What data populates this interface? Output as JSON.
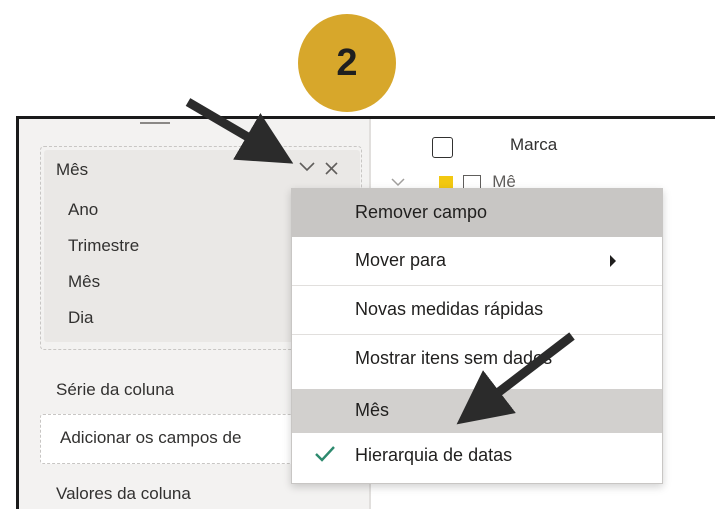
{
  "badge": {
    "number": "2",
    "color": "#d7a72b"
  },
  "left_panel": {
    "field": {
      "title": "Mês",
      "sub_items": [
        "Ano",
        "Trimestre",
        "Mês",
        "Dia"
      ]
    },
    "column_series_label": "Série da coluna",
    "column_series_placeholder": "Adicionar os campos de",
    "column_values_label": "Valores da coluna"
  },
  "right_panel": {
    "field_brand": "Marca",
    "field_month_partial": "Mê"
  },
  "context_menu": {
    "items": [
      {
        "label": "Remover campo",
        "highlighted": true
      },
      {
        "label": "Mover para",
        "has_submenu": true
      },
      {
        "label": "Novas medidas rápidas"
      },
      {
        "label": "Mostrar itens sem dados"
      },
      {
        "label": "Mês",
        "highlighted": true
      },
      {
        "label": "Hierarquia de datas",
        "checked": true
      }
    ]
  },
  "colors": {
    "check": "#2d8a6e",
    "arrow": "#2b2b2b",
    "highlight": "#c8c6c4"
  }
}
